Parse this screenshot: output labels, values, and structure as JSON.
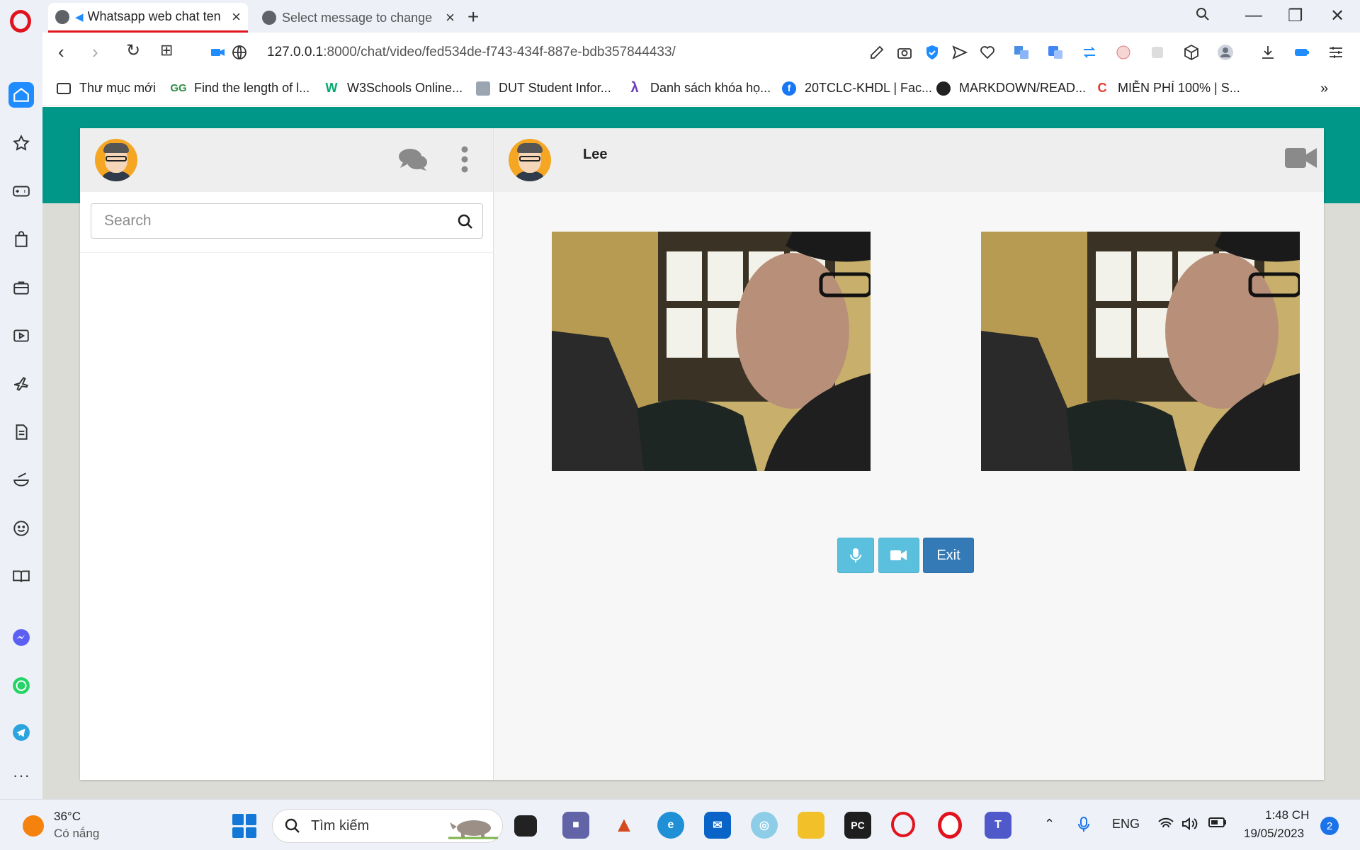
{
  "browser": {
    "tabs": [
      {
        "title": "Whatsapp web chat ten",
        "active": true
      },
      {
        "title": "Select message to change",
        "active": false
      }
    ],
    "url_host": "127.0.0.1",
    "url_rest": ":8000/chat/video/fed534de-f743-434f-887e-bdb357844433/",
    "bookmarks": [
      {
        "label": "Thư mục mới",
        "icon": "folder-icon"
      },
      {
        "label": "Find the length of l...",
        "icon": "gfg-icon"
      },
      {
        "label": "W3Schools Online...",
        "icon": "w3schools-icon"
      },
      {
        "label": "DUT Student Infor...",
        "icon": "dut-icon"
      },
      {
        "label": "Danh sách khóa họ...",
        "icon": "course-icon"
      },
      {
        "label": "20TCLC-KHDL | Fac...",
        "icon": "facebook-icon"
      },
      {
        "label": "MARKDOWN/READ...",
        "icon": "github-icon"
      },
      {
        "label": "MIỄN PHÍ 100% | S...",
        "icon": "c-icon"
      }
    ]
  },
  "app": {
    "search_placeholder": "Search",
    "contact_name": "Lee",
    "buttons": {
      "mic": "microphone-icon",
      "camera": "video-camera-icon",
      "exit": "Exit"
    },
    "colors": {
      "header_band": "#009688",
      "btn_info": "#5bc0de",
      "btn_primary": "#337ab7"
    }
  },
  "taskbar": {
    "weather_temp": "36°C",
    "weather_desc": "Có nắng",
    "search_label": "Tìm kiếm",
    "lang": "ENG",
    "time": "1:48 CH",
    "date": "19/05/2023",
    "notifications": "2"
  }
}
